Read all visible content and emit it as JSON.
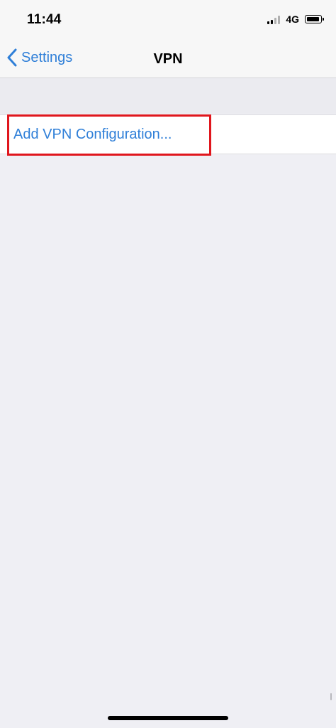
{
  "status_bar": {
    "time": "11:44",
    "network": "4G",
    "icons": [
      "signal-icon",
      "battery-icon"
    ]
  },
  "nav": {
    "back_label": "Settings",
    "back_icon": "chevron-left-icon",
    "title": "VPN"
  },
  "content": {
    "add_config_label": "Add VPN Configuration..."
  },
  "colors": {
    "accent": "#2f7fd8",
    "highlight": "#e0161d",
    "background": "#efeff4"
  }
}
